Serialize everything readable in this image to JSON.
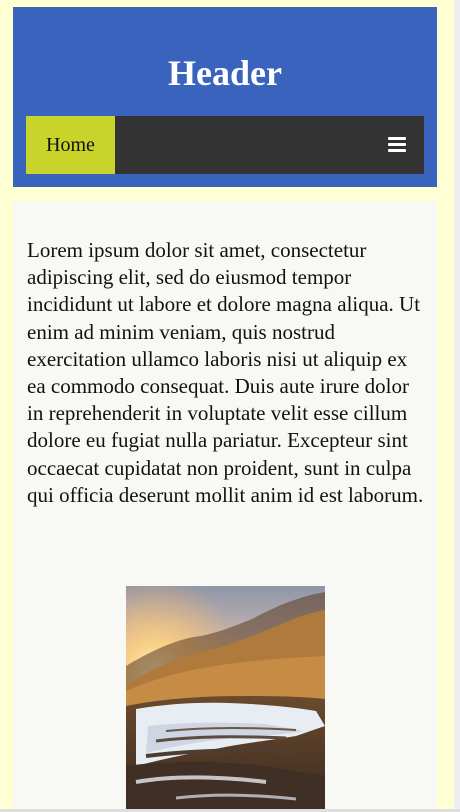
{
  "header": {
    "title": "Header"
  },
  "nav": {
    "home_label": "Home",
    "menu_icon": "hamburger-menu-icon"
  },
  "content": {
    "paragraph": "Lorem ipsum dolor sit amet, consectetur adipiscing elit, sed do eiusmod tempor incididunt ut labore et dolore magna aliqua. Ut enim ad minim veniam, quis nostrud exercitation ullamco laboris nisi ut aliquip ex ea commodo consequat. Duis aute irure dolor in reprehenderit in voluptate velit esse cillum dolore eu fugiat nulla pariatur. Excepteur sint occaecat cupidatat non proident, sunt in culpa qui officia deserunt mollit anim id est laborum."
  },
  "colors": {
    "page_bg": "#ffffd4",
    "header_bg": "#3a63be",
    "nav_bg": "#333333",
    "nav_active": "#c8d42a",
    "content_bg": "#f8f8f5"
  }
}
